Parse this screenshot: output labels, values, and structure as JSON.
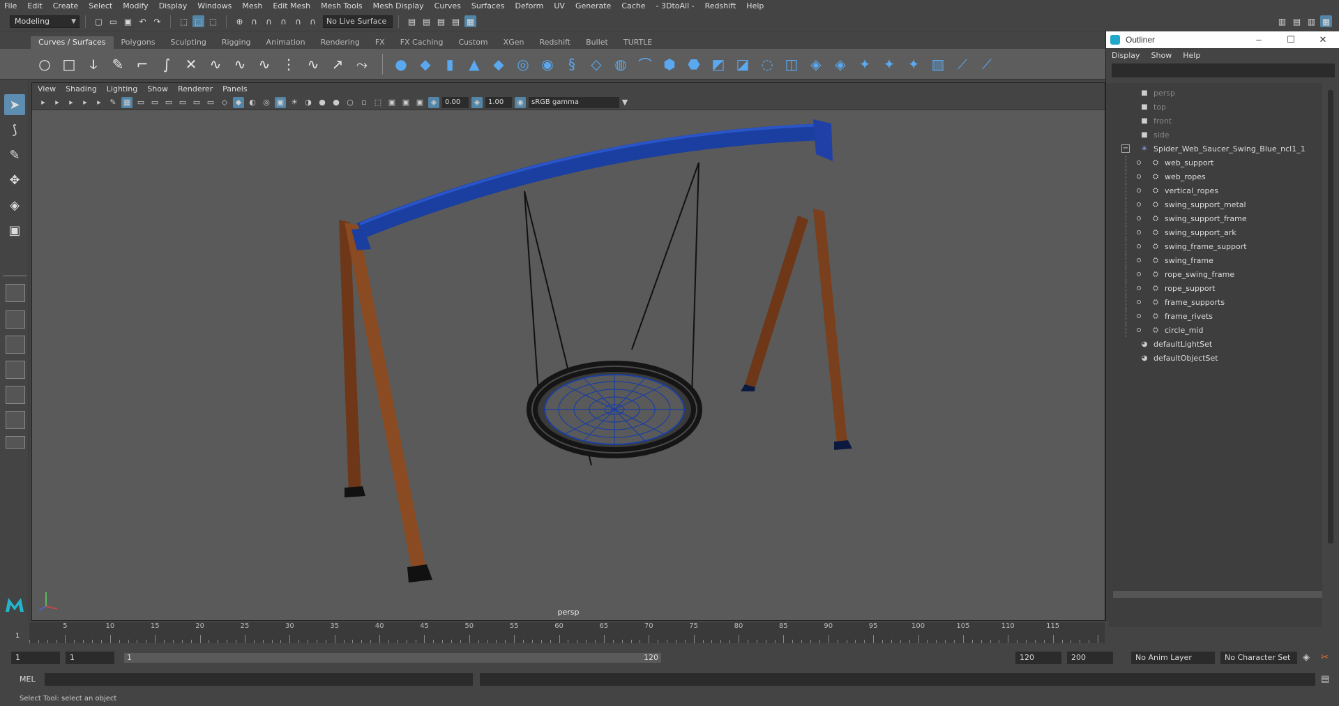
{
  "menubar": [
    "File",
    "Edit",
    "Create",
    "Select",
    "Modify",
    "Display",
    "Windows",
    "Mesh",
    "Edit Mesh",
    "Mesh Tools",
    "Mesh Display",
    "Curves",
    "Surfaces",
    "Deform",
    "UV",
    "Generate",
    "Cache",
    "- 3DtoAll -",
    "Redshift",
    "Help"
  ],
  "statusline": {
    "mode": "Modeling",
    "live_surface": "No Live Surface"
  },
  "shelf_tabs": [
    "Curves / Surfaces",
    "Polygons",
    "Sculpting",
    "Rigging",
    "Animation",
    "Rendering",
    "FX",
    "FX Caching",
    "Custom",
    "XGen",
    "Redshift",
    "Bullet",
    "TURTLE"
  ],
  "shelf_active_tab": "Curves / Surfaces",
  "viewport": {
    "menu": [
      "View",
      "Shading",
      "Lighting",
      "Show",
      "Renderer",
      "Panels"
    ],
    "exposure": "0.00",
    "gamma": "1.00",
    "color_space": "sRGB gamma",
    "camera_label": "persp"
  },
  "outliner": {
    "title": "Outliner",
    "menu": [
      "Display",
      "Show",
      "Help"
    ],
    "items": [
      {
        "label": "persp",
        "type": "camera",
        "dim": true,
        "indent": 0
      },
      {
        "label": "top",
        "type": "camera",
        "dim": true,
        "indent": 0
      },
      {
        "label": "front",
        "type": "camera",
        "dim": true,
        "indent": 0
      },
      {
        "label": "side",
        "type": "camera",
        "dim": true,
        "indent": 0
      },
      {
        "label": "Spider_Web_Saucer_Swing_Blue_ncl1_1",
        "type": "group",
        "dim": false,
        "indent": 0
      },
      {
        "label": "web_support",
        "type": "mesh",
        "dim": false,
        "indent": 1
      },
      {
        "label": "web_ropes",
        "type": "mesh",
        "dim": false,
        "indent": 1
      },
      {
        "label": "vertical_ropes",
        "type": "mesh",
        "dim": false,
        "indent": 1
      },
      {
        "label": "swing_support_metal",
        "type": "mesh",
        "dim": false,
        "indent": 1
      },
      {
        "label": "swing_support_frame",
        "type": "mesh",
        "dim": false,
        "indent": 1
      },
      {
        "label": "swing_support_ark",
        "type": "mesh",
        "dim": false,
        "indent": 1
      },
      {
        "label": "swing_frame_support",
        "type": "mesh",
        "dim": false,
        "indent": 1
      },
      {
        "label": "swing_frame",
        "type": "mesh",
        "dim": false,
        "indent": 1
      },
      {
        "label": "rope_swing_frame",
        "type": "mesh",
        "dim": false,
        "indent": 1
      },
      {
        "label": "rope_support",
        "type": "mesh",
        "dim": false,
        "indent": 1
      },
      {
        "label": "frame_supports",
        "type": "mesh",
        "dim": false,
        "indent": 1
      },
      {
        "label": "frame_rivets",
        "type": "mesh",
        "dim": false,
        "indent": 1
      },
      {
        "label": "circle_mid",
        "type": "mesh",
        "dim": false,
        "indent": 1
      },
      {
        "label": "defaultLightSet",
        "type": "set",
        "dim": false,
        "indent": 0
      },
      {
        "label": "defaultObjectSet",
        "type": "set",
        "dim": false,
        "indent": 0
      }
    ]
  },
  "timeslider": {
    "ticks": [
      "5",
      "10",
      "15",
      "20",
      "25",
      "30",
      "35",
      "40",
      "45",
      "50",
      "55",
      "60",
      "65",
      "70",
      "75",
      "80",
      "85",
      "90",
      "95",
      "100",
      "105",
      "110",
      "115"
    ],
    "current_frame": "1"
  },
  "range": {
    "start": "1",
    "playback_start": "1",
    "inner_start": "1",
    "inner_end": "120",
    "playback_end": "120",
    "end": "200",
    "anim_layer": "No Anim Layer",
    "character_set": "No Character Set"
  },
  "cmdline": {
    "lang": "MEL"
  },
  "helpline": "Select Tool: select an object",
  "colors": {
    "accent": "#5285a6",
    "frame_blue": "#1a3fa0",
    "wood": "#7a3f1c"
  }
}
